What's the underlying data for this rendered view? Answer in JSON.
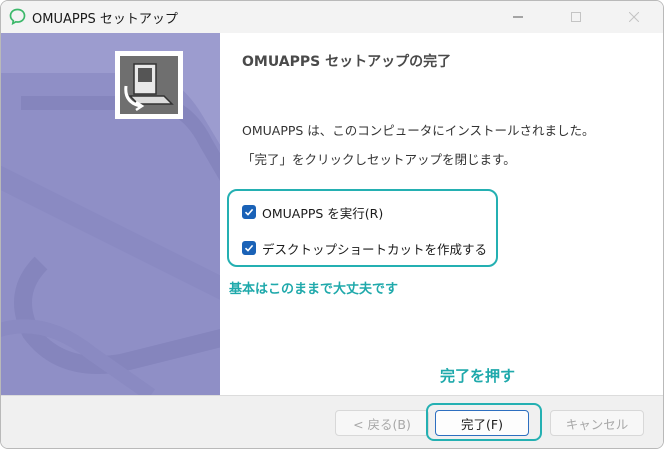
{
  "window": {
    "title": "OMUAPPS セットアップ",
    "controls": {
      "minimize_icon": "minimize-icon",
      "maximize_icon": "maximize-icon",
      "close_icon": "close-icon"
    }
  },
  "content": {
    "heading": "OMUAPPS セットアップの完了",
    "message1": "OMUAPPS は、このコンピュータにインストールされました。",
    "message2": "「完了」をクリックしセットアップを閉じます。",
    "options": [
      {
        "label": "OMUAPPS を実行(R)",
        "checked": true
      },
      {
        "label": "デスクトップショートカットを作成する",
        "checked": true
      }
    ],
    "annotation_options": "基本はこのままで大丈夫です",
    "annotation_finish": "完了を押す"
  },
  "buttons": {
    "back": "< 戻る(B)",
    "finish": "完了(F)",
    "cancel": "キャンセル"
  },
  "colors": {
    "banner": "#9c9ccf",
    "accent_teal": "#24b0b2",
    "checkbox_blue": "#1a62b7"
  }
}
